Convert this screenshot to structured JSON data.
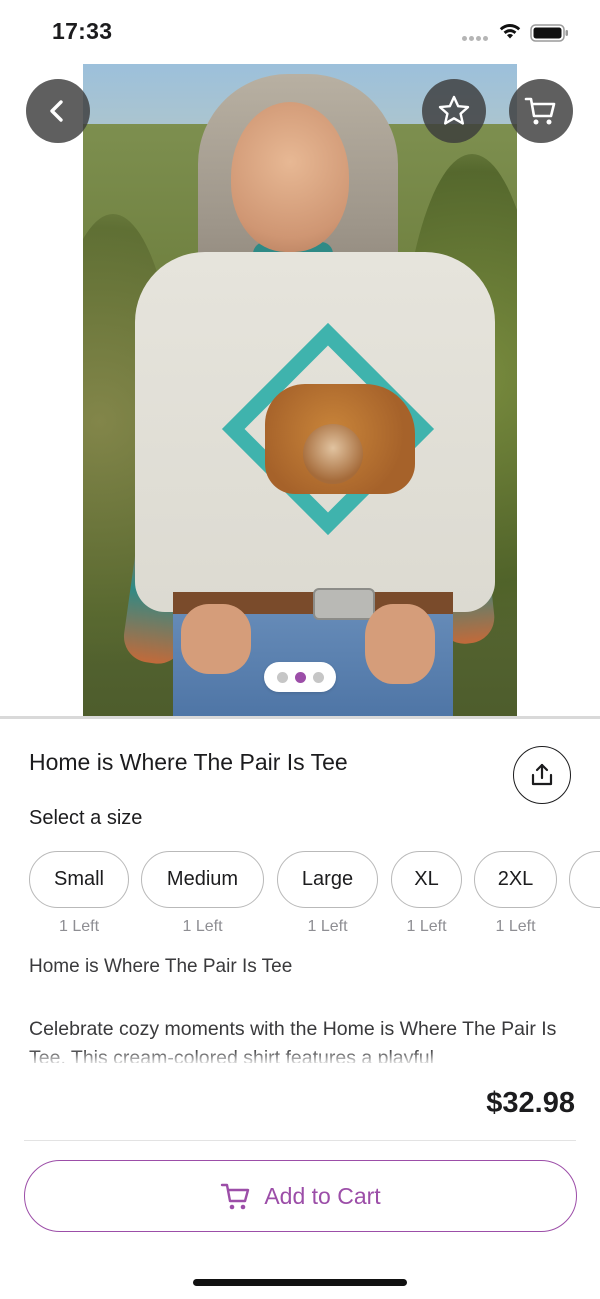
{
  "status_bar": {
    "time": "17:33"
  },
  "product": {
    "title": "Home is Where The Pair Is Tee",
    "price": "$32.98",
    "image_pager": {
      "count": 3,
      "active_index": 1
    }
  },
  "size_selector": {
    "label": "Select a size",
    "sizes": [
      {
        "label": "Small",
        "stock": "1 Left"
      },
      {
        "label": "Medium",
        "stock": "1 Left"
      },
      {
        "label": "Large",
        "stock": "1 Left"
      },
      {
        "label": "XL",
        "stock": "1 Left"
      },
      {
        "label": "2XL",
        "stock": "1 Left"
      }
    ]
  },
  "description": {
    "title": "Home is Where The Pair Is Tee",
    "body": "Celebrate cozy moments with the Home is Where The Pair Is Tee. This cream-colored shirt features a playful"
  },
  "actions": {
    "add_to_cart": "Add to Cart"
  },
  "icons": {
    "back": "chevron-left-icon",
    "favorite": "star-icon",
    "cart": "cart-icon",
    "share": "share-icon"
  },
  "colors": {
    "accent": "#9c4ea8",
    "text": "#1c1c1e",
    "muted": "#8e8e93",
    "button_overlay": "#3c3c3c"
  }
}
